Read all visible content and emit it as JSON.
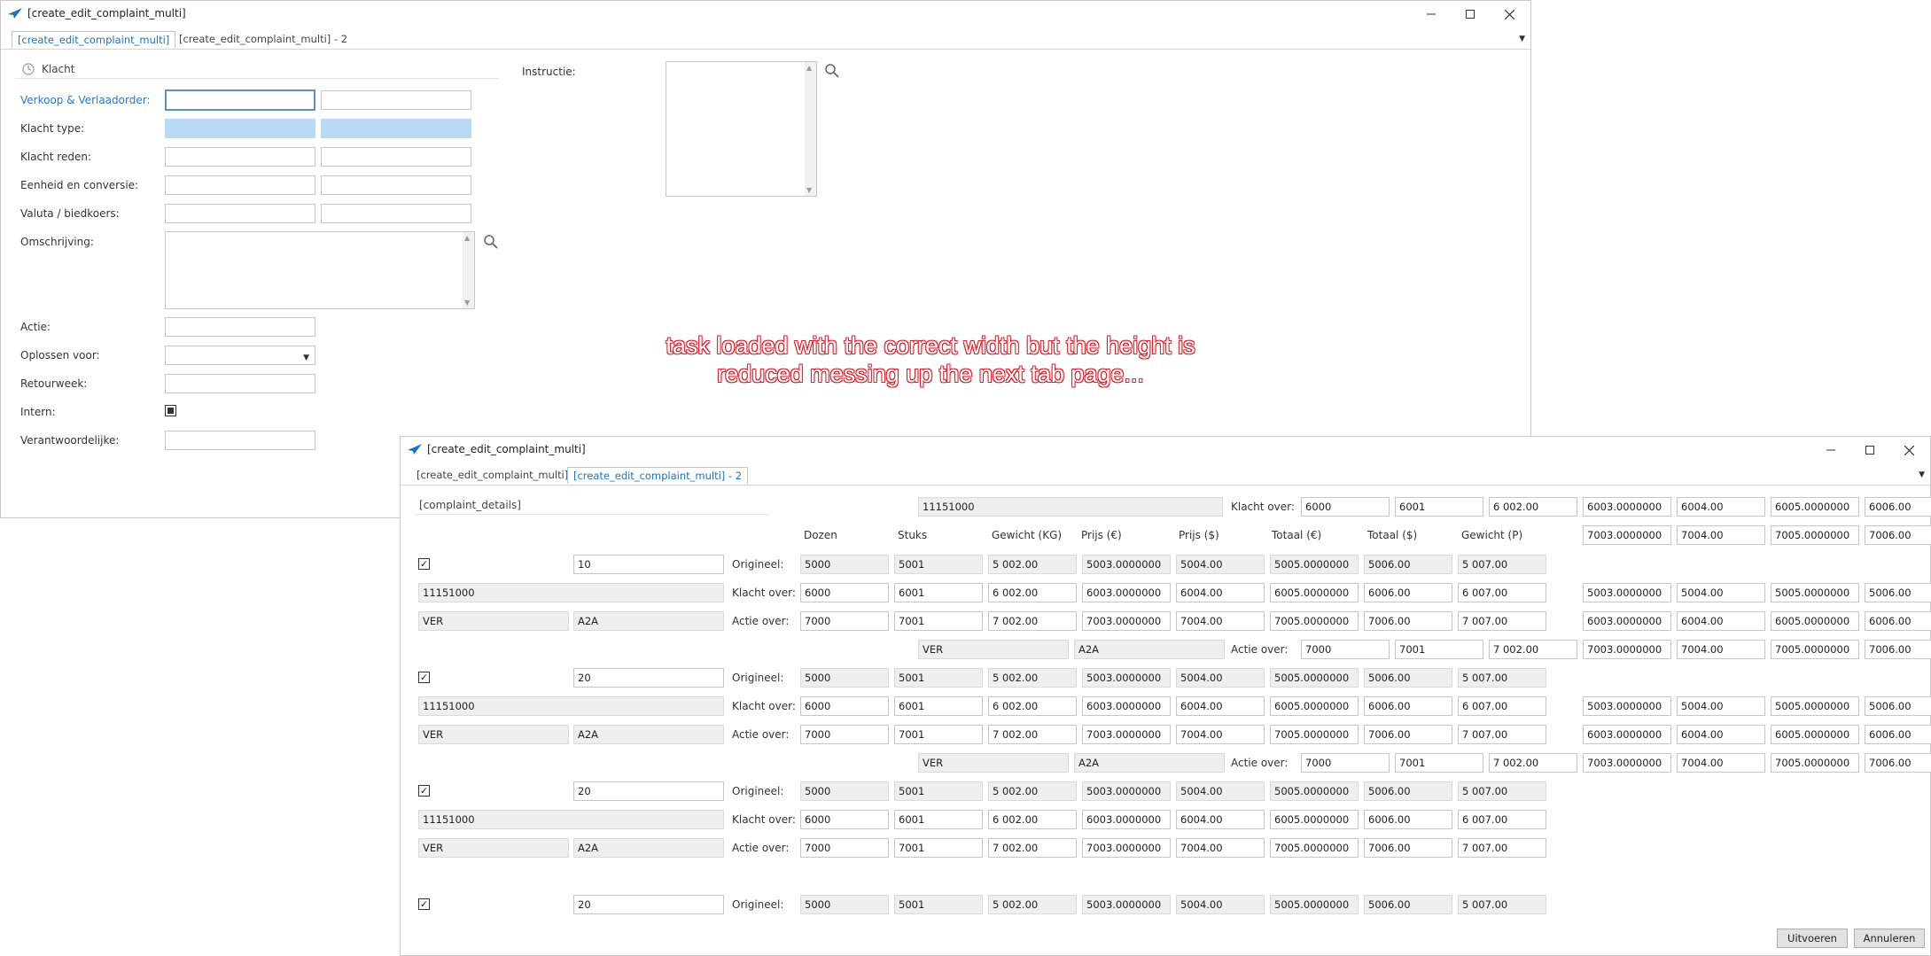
{
  "window1": {
    "title": "[create_edit_complaint_multi]",
    "tabs": [
      "[create_edit_complaint_multi]",
      "[create_edit_complaint_multi] - 2"
    ],
    "section": "Klacht",
    "labels": {
      "verkoop": "Verkoop & Verlaadorder:",
      "type": "Klacht type:",
      "reden": "Klacht reden:",
      "eenheid": "Eenheid en conversie:",
      "valuta": "Valuta / biedkoers:",
      "omschrijving": "Omschrijving:",
      "actie": "Actie:",
      "oplossen": "Oplossen voor:",
      "retourweek": "Retourweek:",
      "intern": "Intern:",
      "verantwoordelijke": "Verantwoordelijke:",
      "instructie": "Instructie:"
    }
  },
  "annotation": {
    "line1": "task loaded with the correct width but the height is",
    "line2": "reduced messing up the next tab page..."
  },
  "window2": {
    "title": "[create_edit_complaint_multi]",
    "tabs": [
      "[create_edit_complaint_multi]",
      "[create_edit_complaint_multi] - 2"
    ],
    "section": "[complaint_details]",
    "headers": [
      "Dozen",
      "Stuks",
      "Gewicht (KG)",
      "Prijs (€)",
      "Prijs ($)",
      "Totaal (€)",
      "Totaal ($)",
      "Gewicht (P)"
    ],
    "origineel": "Origineel:",
    "klacht_over": "Klacht over:",
    "actie_over": "Actie over:",
    "top_code": "11151000",
    "top_row": [
      "6000",
      "6001",
      "6 002.00",
      "6003.0000000",
      "6004.00",
      "6005.0000000",
      "6006.00"
    ],
    "top_row2": [
      "7003.0000000",
      "7004.00",
      "7005.0000000",
      "7006.00"
    ],
    "orig_values": [
      "5000",
      "5001",
      "5 002.00",
      "5003.0000000",
      "5004.00",
      "5005.0000000",
      "5006.00",
      "5 007.00"
    ],
    "klacht_values": [
      "6000",
      "6001",
      "6 002.00",
      "6003.0000000",
      "6004.00",
      "6005.0000000",
      "6006.00",
      "6 007.00"
    ],
    "actie_values": [
      "7000",
      "7001",
      "7 002.00",
      "7003.0000000",
      "7004.00",
      "7005.0000000",
      "7006.00",
      "7 007.00"
    ],
    "right_klacht": [
      "5003.0000000",
      "5004.00",
      "5005.0000000",
      "5006.00"
    ],
    "right_actie": [
      "6003.0000000",
      "6004.00",
      "6005.0000000",
      "6006.00"
    ],
    "mid_actie_values": [
      "7000",
      "7001",
      "7 002.00",
      "7003.0000000",
      "7004.00",
      "7005.0000000",
      "7006.00"
    ],
    "ver": "VER",
    "a2a": "A2A",
    "groups": [
      {
        "qty": "10"
      },
      {
        "qty": "20"
      },
      {
        "qty": "20"
      },
      {
        "qty": "20"
      }
    ],
    "buttons": {
      "uitvoeren": "Uitvoeren",
      "annuleren": "Annuleren"
    }
  }
}
